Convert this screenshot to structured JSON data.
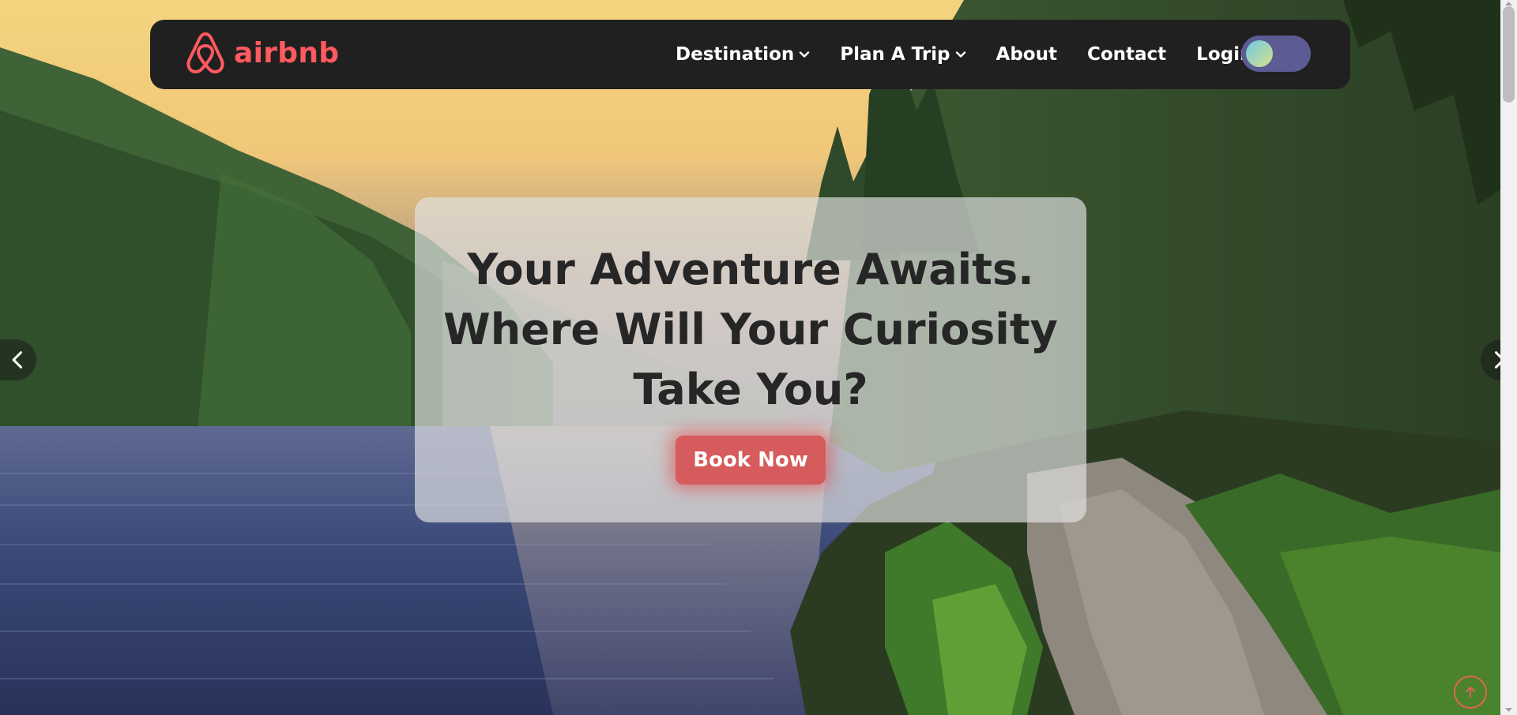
{
  "brand": {
    "name": "airbnb",
    "color": "#ff5a5f",
    "logo_icon": "airbnb-belo-icon"
  },
  "nav": {
    "items": [
      {
        "label": "Destination",
        "has_dropdown": true
      },
      {
        "label": "Plan A Trip",
        "has_dropdown": true
      },
      {
        "label": "About",
        "has_dropdown": false
      },
      {
        "label": "Contact",
        "has_dropdown": false
      },
      {
        "label": "Login",
        "has_dropdown": false
      }
    ],
    "theme_toggle_icon": "theme-toggle-switch"
  },
  "hero": {
    "headline": "Your Adventure Awaits. Where Will Your Curiosity Take You?",
    "cta_label": "Book Now",
    "cta_color": "#d55b5c",
    "prev_icon": "chevron-left-icon",
    "next_icon": "chevron-right-icon"
  },
  "scroll_top_icon": "arrow-up-icon"
}
